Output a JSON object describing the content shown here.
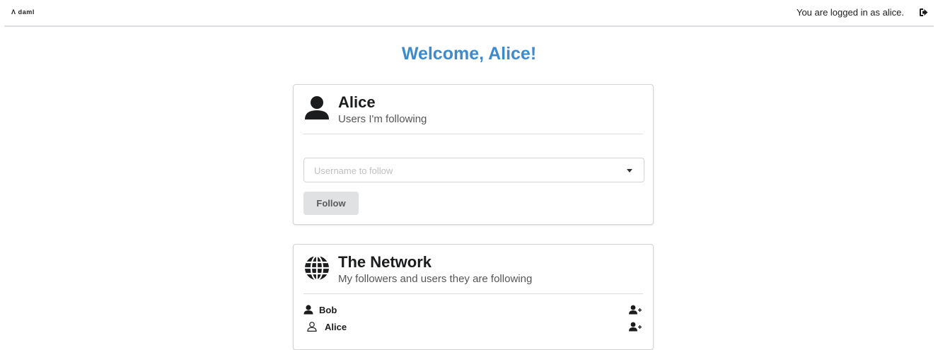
{
  "header": {
    "brand_mark": "Λ",
    "brand_name": "daml",
    "logged_in_text": "You are logged in as alice."
  },
  "welcome": "Welcome, Alice!",
  "profile_card": {
    "icon": "user-icon",
    "title": "Alice",
    "subtitle": "Users I'm following",
    "username_select_placeholder": "Username to follow",
    "follow_label": "Follow"
  },
  "network_card": {
    "icon": "globe-icon",
    "title": "The Network",
    "subtitle": "My followers and users they are following",
    "users": [
      {
        "name": "Bob",
        "icon": "user-icon"
      },
      {
        "name": "Alice",
        "icon": "user-outline-icon"
      }
    ]
  },
  "colors": {
    "accent": "#3d8bcd",
    "button_bg": "#e0e1e2"
  }
}
